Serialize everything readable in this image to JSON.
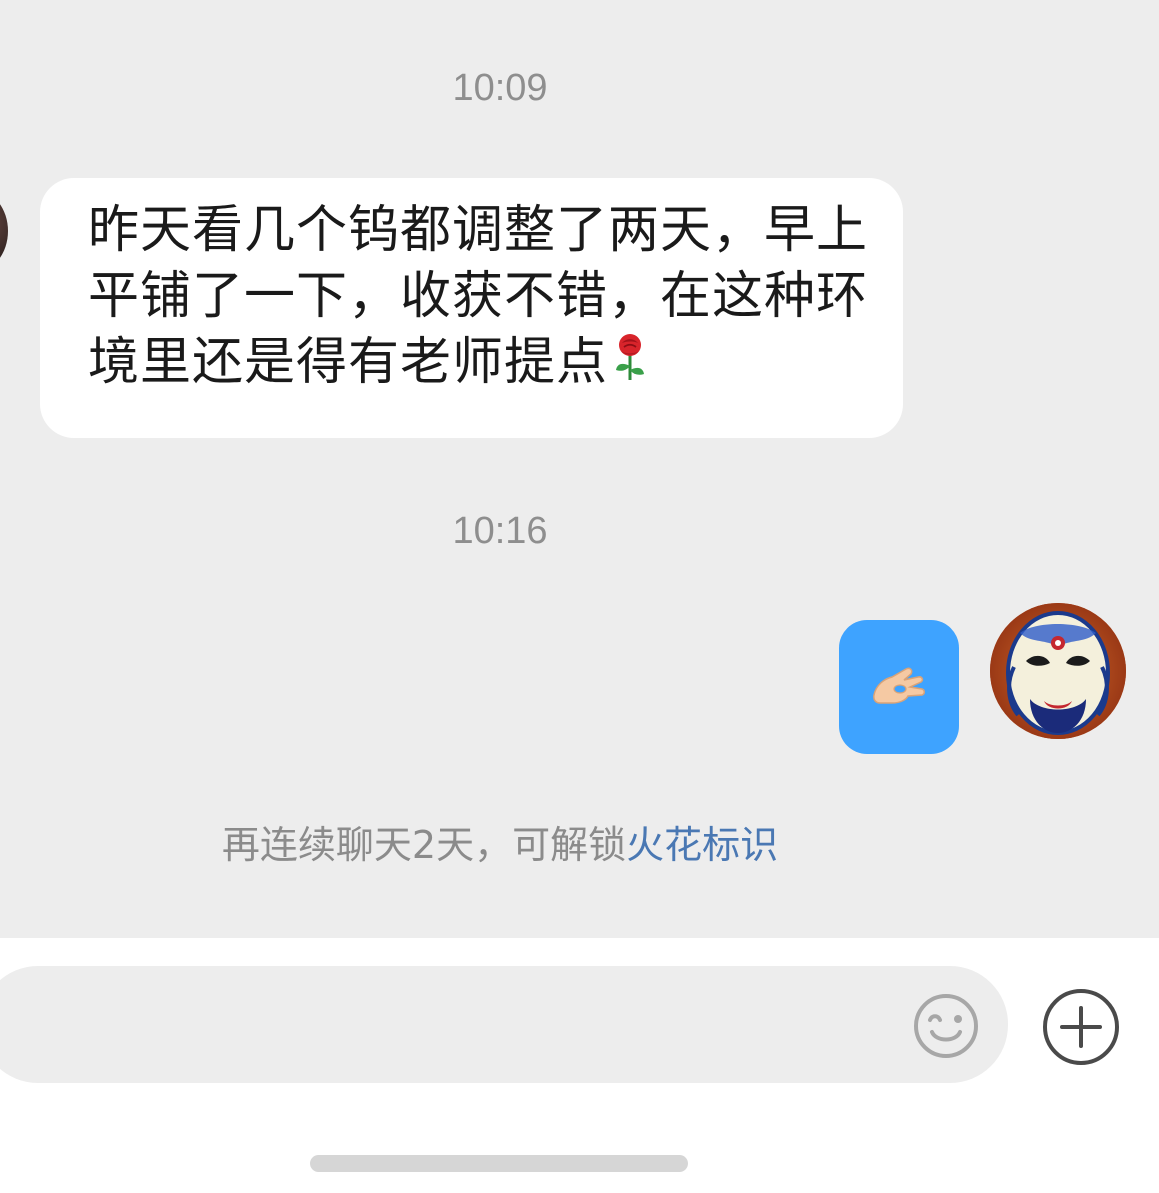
{
  "conversation": {
    "messages": [
      {
        "time": "10:09",
        "sender": "peer",
        "text": "昨天看几个钨都调整了两天，早上平铺了一下，收获不错，在这种环境里还是得有老师提点",
        "emoji": "rose-emoji"
      },
      {
        "time": "10:16",
        "sender": "self",
        "emoji": "ok-hand-emoji"
      }
    ],
    "notice": {
      "prefix": "再连续聊天2天，可解锁",
      "link": "火花标识"
    }
  },
  "input": {
    "value": "",
    "placeholder": ""
  },
  "colors": {
    "chat_background": "#ededed",
    "incoming_bubble": "#ffffff",
    "outgoing_bubble": "#3ea3ff",
    "link": "#4a78b3",
    "timestamp": "#8e8e8e"
  },
  "icons": {
    "emoji_button": "smiley-face-icon",
    "more_button": "plus-circle-icon"
  }
}
